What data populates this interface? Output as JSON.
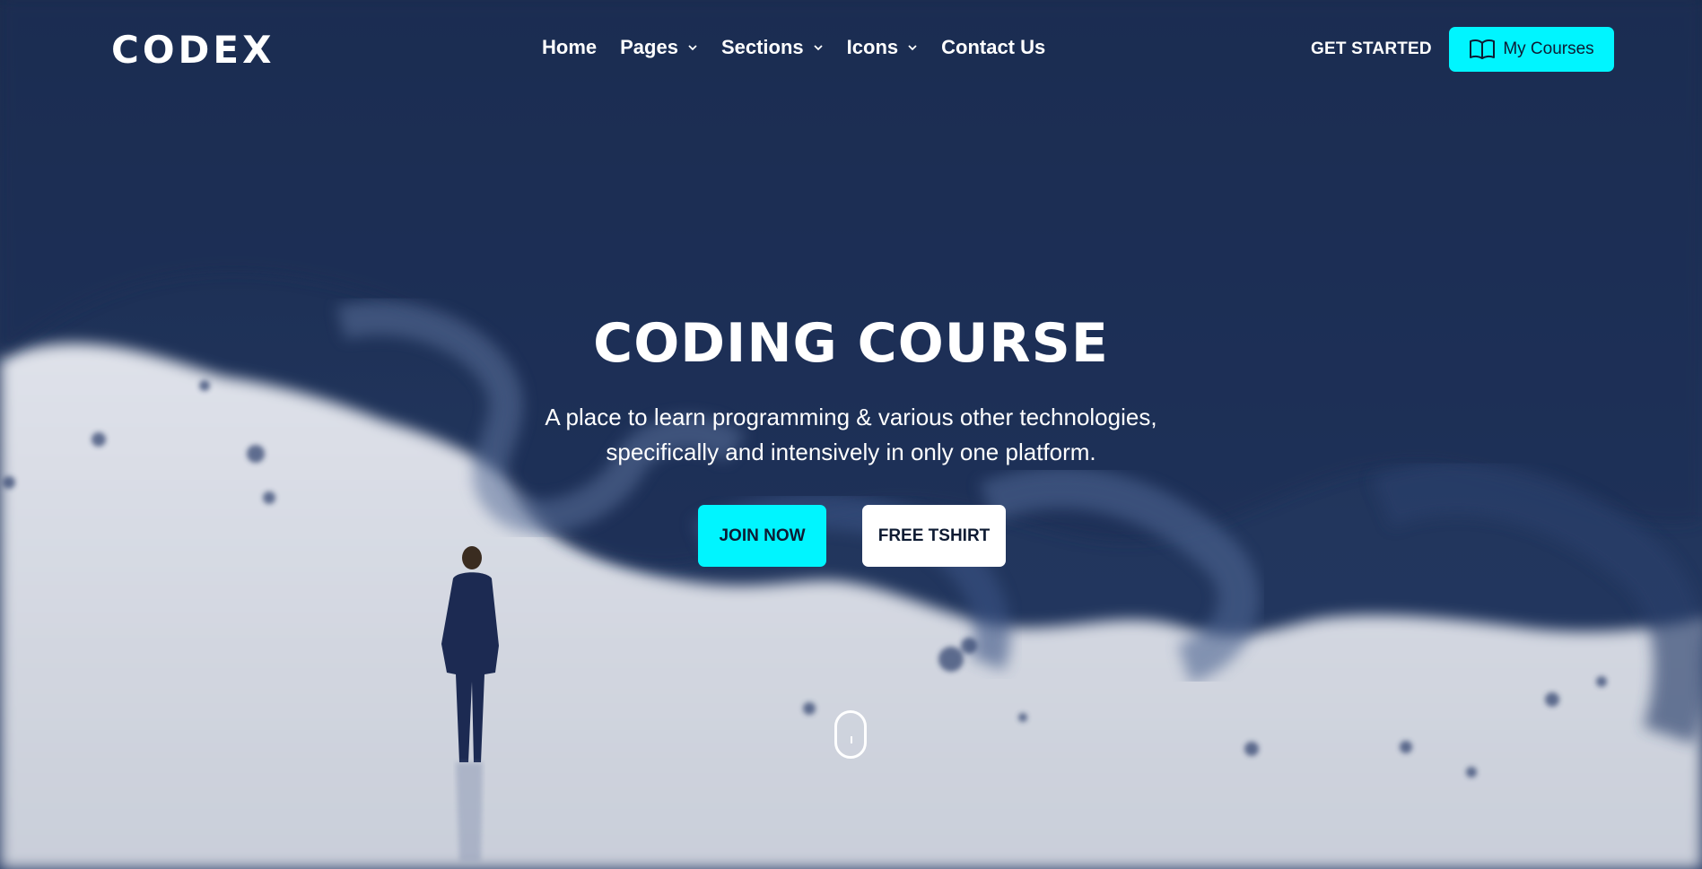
{
  "brand": {
    "logo_text": "CODEX"
  },
  "nav": {
    "items": [
      {
        "label": "Home",
        "has_dropdown": false
      },
      {
        "label": "Pages",
        "has_dropdown": true
      },
      {
        "label": "Sections",
        "has_dropdown": true
      },
      {
        "label": "Icons",
        "has_dropdown": true
      },
      {
        "label": "Contact Us",
        "has_dropdown": false
      }
    ],
    "get_started": "GET STARTED",
    "my_courses": "My Courses",
    "my_courses_icon": "book-open-icon"
  },
  "hero": {
    "title": "CODING COURSE",
    "subtitle": "A place to learn programming & various other technologies, specifically and intensively in only one platform.",
    "join_button": "JOIN NOW",
    "tshirt_button": "FREE TSHIRT",
    "scroll_icon": "mouse-scroll-icon"
  },
  "colors": {
    "accent": "#00f5ff",
    "navy": "#1e3157",
    "white": "#ffffff"
  }
}
